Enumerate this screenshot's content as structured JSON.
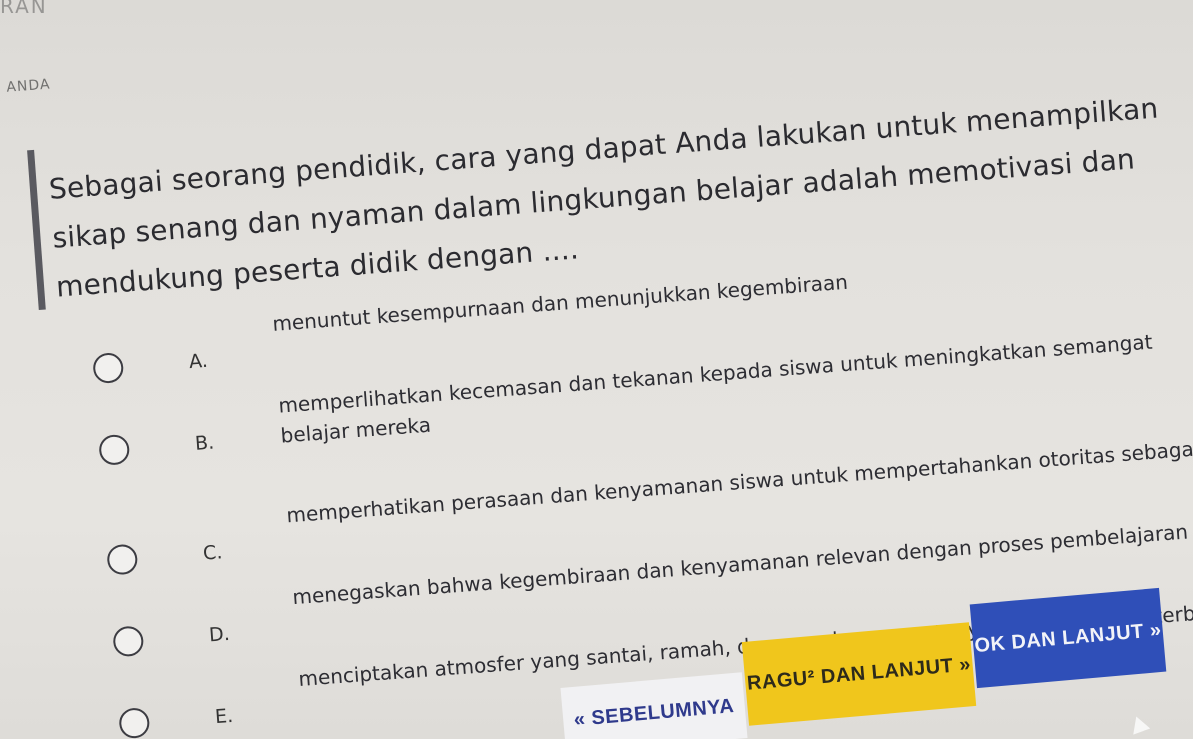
{
  "header": {
    "cut_text": "RAN",
    "cut_text_2": "ANDA"
  },
  "question": {
    "text": "Sebagai seorang pendidik, cara yang dapat Anda lakukan untuk menampilkan sikap senang dan nyaman dalam lingkungan belajar adalah memotivasi dan mendukung peserta didik dengan ...."
  },
  "options": [
    {
      "letter": "A.",
      "text": "menuntut kesempurnaan dan menunjukkan kegembiraan"
    },
    {
      "letter": "B.",
      "text": "memperlihatkan kecemasan dan tekanan kepada siswa untuk meningkatkan semangat belajar mereka"
    },
    {
      "letter": "C.",
      "text": "memperhatikan perasaan dan kenyamanan siswa untuk mempertahankan otoritas sebagai guru"
    },
    {
      "letter": "D.",
      "text": "menegaskan bahwa kegembiraan dan kenyamanan relevan dengan proses pembelajaran"
    },
    {
      "letter": "E.",
      "text": "menciptakan atmosfer yang santai, ramah, dan mendorong pertanyaan serta diskusi terbuka"
    }
  ],
  "buttons": {
    "prev_label": "« SEBELUMNYA",
    "ragu_label": "RAGU² DAN LANJUT »",
    "ok_label": "OK DAN LANJUT »"
  },
  "colors": {
    "prev_bg": "#f1f1f3",
    "ragu_bg": "#f0c61c",
    "ok_bg": "#2f4fb8"
  }
}
